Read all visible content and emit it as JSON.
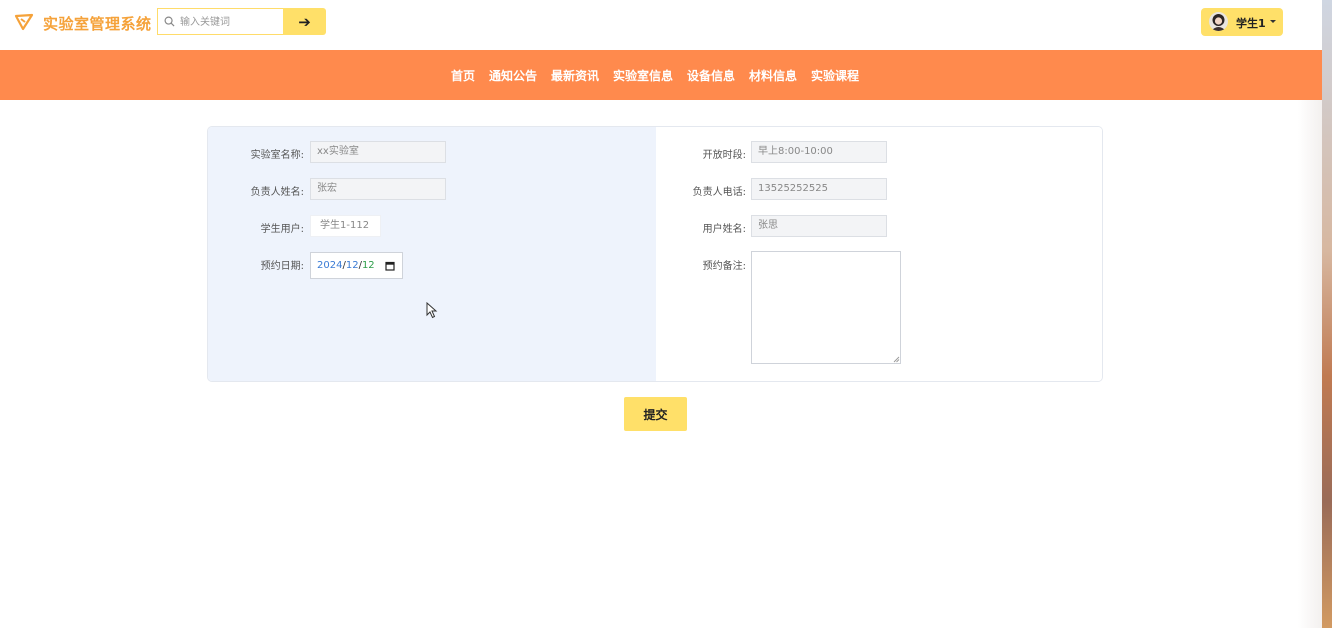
{
  "header": {
    "app_title": "实验室管理系统",
    "logo_icon": "paper-plane-icon",
    "search_placeholder": "输入关键词",
    "search_icon": "search-icon",
    "search_button_icon": "arrow-right-icon",
    "user_name": "学生1",
    "colors": {
      "accent": "#ffe069",
      "brand_text": "#f5a23a"
    }
  },
  "nav": {
    "background": "#ff8a4d",
    "items": [
      "首页",
      "通知公告",
      "最新资讯",
      "实验室信息",
      "设备信息",
      "材料信息",
      "实验课程"
    ]
  },
  "form": {
    "lab_name": {
      "label": "实验室名称:",
      "value": "xx实验室"
    },
    "open_period": {
      "label": "开放时段:",
      "value": "早上8:00-10:00"
    },
    "manager_name": {
      "label": "负责人姓名:",
      "value": "张宏"
    },
    "manager_phone": {
      "label": "负责人电话:",
      "value": "13525252525"
    },
    "student_user": {
      "label": "学生用户:",
      "value": "学生1-112"
    },
    "user_name": {
      "label": "用户姓名:",
      "value": "张思"
    },
    "booking_date": {
      "label": "预约日期:",
      "year": "2024",
      "month": "12",
      "day": "12",
      "sep": "/"
    },
    "booking_note": {
      "label": "预约备注:",
      "value": ""
    }
  },
  "submit_label": "提交"
}
